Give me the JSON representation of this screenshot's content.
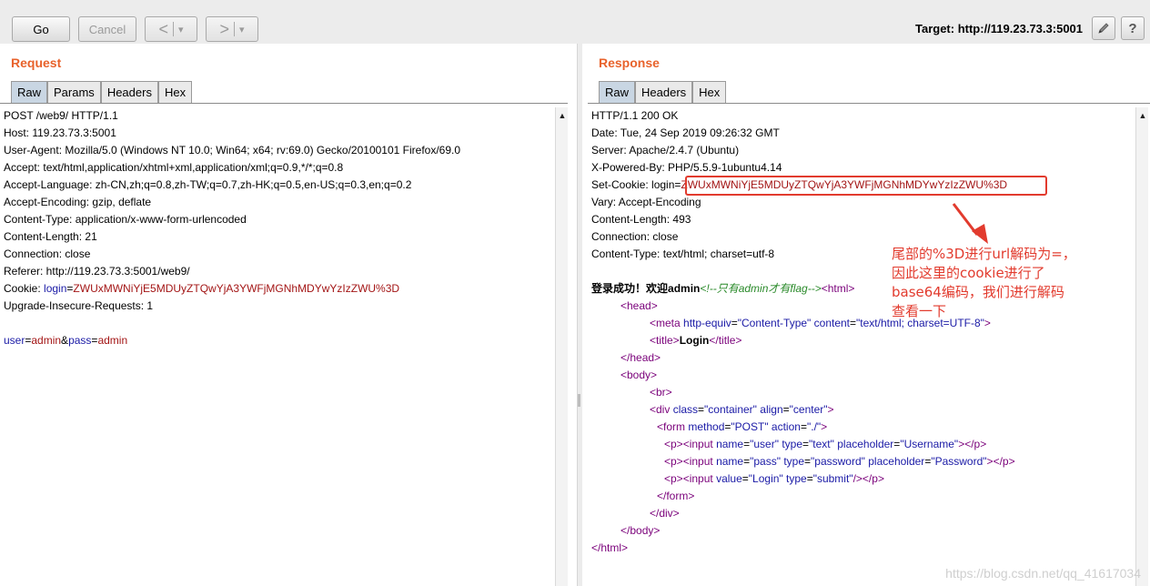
{
  "toolbar": {
    "go_label": "Go",
    "cancel_label": "Cancel",
    "back_label": "<",
    "back_menu": "▾",
    "forward_label": ">",
    "forward_menu": "▾",
    "target_label": "Target: http://119.23.73.3:5001",
    "edit_icon": "pencil-icon",
    "help_label": "?"
  },
  "request": {
    "title": "Request",
    "tabs": [
      "Raw",
      "Params",
      "Headers",
      "Hex"
    ],
    "lines": [
      "POST /web9/ HTTP/1.1",
      "Host: 119.23.73.3:5001",
      "User-Agent: Mozilla/5.0 (Windows NT 10.0; Win64; x64; rv:69.0) Gecko/20100101 Firefox/69.0",
      "Accept: text/html,application/xhtml+xml,application/xml;q=0.9,*/*;q=0.8",
      "Accept-Language: zh-CN,zh;q=0.8,zh-TW;q=0.7,zh-HK;q=0.5,en-US;q=0.3,en;q=0.2",
      "Accept-Encoding: gzip, deflate",
      "Content-Type: application/x-www-form-urlencoded",
      "Content-Length: 21",
      "Connection: close",
      "Referer: http://119.23.73.3:5001/web9/"
    ],
    "cookie_key": "Cookie: ",
    "cookie_name": "login",
    "cookie_eq": "=",
    "cookie_value": "ZWUxMWNiYjE5MDUyZTQwYjA3YWFjMGNhMDYwYzIzZWU%3D",
    "upgrade": "Upgrade-Insecure-Requests: 1",
    "body_k1": "user",
    "body_eq1": "=",
    "body_v1": "admin",
    "body_amp": "&",
    "body_k2": "pass",
    "body_eq2": "=",
    "body_v2": "admin"
  },
  "response": {
    "title": "Response",
    "tabs": [
      "Raw",
      "Headers",
      "Hex"
    ],
    "lines": [
      "HTTP/1.1 200 OK",
      "Date: Tue, 24 Sep 2019 09:26:32 GMT",
      "Server: Apache/2.4.7 (Ubuntu)",
      "X-Powered-By: PHP/5.5.9-1ubuntu4.14"
    ],
    "setcookie_key": "Set-Cookie: login=",
    "setcookie_value": "ZWUxMWNiYjE5MDUyZTQwYjA3YWFjMGNhMDYwYzIzZWU%3D",
    "lines2": [
      "Vary: Accept-Encoding",
      "Content-Length: 493",
      "Connection: close",
      "Content-Type: text/html; charset=utf-8"
    ],
    "html_text": "登录成功！欢迎",
    "html_bold": "admin",
    "html_comment": "<!--只有admin才有flag-->",
    "html_open": "<html>",
    "head_open": "<head>",
    "meta_open": "<meta ",
    "meta_attr1": "http-equiv",
    "meta_eq1": "=",
    "meta_val1": "\"Content-Type\"",
    "meta_attr2": " content",
    "meta_eq2": "=",
    "meta_val2": "\"text/html; charset=UTF-8\"",
    "meta_close": ">",
    "title_open": "<title>",
    "title_text": "Login",
    "title_close": "</title>",
    "head_close": "</head>",
    "body_open": "<body>",
    "br": "<br>",
    "div_open": "<div ",
    "div_attr1": "class",
    "div_val1": "\"container\"",
    "div_attr2": " align",
    "div_val2": "\"center\"",
    "div_end": ">",
    "form_open": "<form ",
    "form_attr1": "method",
    "form_val1": "\"POST\"",
    "form_attr2": " action",
    "form_val2": "\"./\"",
    "form_end": ">",
    "p_open": "<p>",
    "input_open": "<input ",
    "in1_name": "\"user\"",
    "in1_type": "\"text\"",
    "in1_ph": "\"Username\"",
    "in2_name": "\"pass\"",
    "in2_type": "\"password\"",
    "in2_ph": "\"Password\"",
    "in3_val": "\"Login\"",
    "in3_type": "\"submit\"",
    "attr_name": "name",
    "attr_type": " type",
    "attr_ph": " placeholder",
    "attr_value": "value",
    "eq": "=",
    "tag_end": ">",
    "tag_selfclose": "/>",
    "p_close": "</p>",
    "form_close": "</form>",
    "div_close": "</div>",
    "body_close": "</body>",
    "html_close": "</html>"
  },
  "annotation": {
    "lines": [
      "尾部的%3D进行url解码为=，",
      "因此这里的cookie进行了",
      "base64编码，我们进行解码",
      "查看一下"
    ]
  },
  "watermark": "https://blog.csdn.net/qq_41617034"
}
